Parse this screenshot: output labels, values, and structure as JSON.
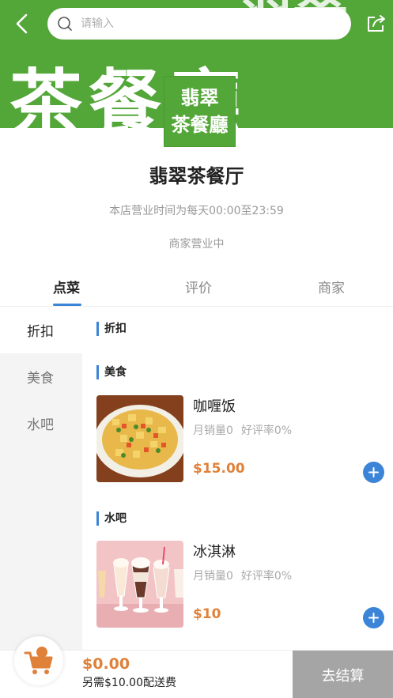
{
  "header": {
    "search_placeholder": "请输入",
    "banner_text_large": "茶餐廳",
    "banner_text_top": "翡翠"
  },
  "store": {
    "logo_line1": "翡翠",
    "logo_line2": "茶餐廳",
    "name": "翡翠茶餐厅",
    "hours": "本店营业时间为每天00:00至23:59",
    "status": "商家营业中",
    "brand_color": "#53a638"
  },
  "tabs": [
    {
      "label": "点菜",
      "active": true
    },
    {
      "label": "评价",
      "active": false
    },
    {
      "label": "商家",
      "active": false
    }
  ],
  "categories": [
    {
      "label": "折扣",
      "active": true
    },
    {
      "label": "美食",
      "active": false
    },
    {
      "label": "水吧",
      "active": false
    }
  ],
  "sections": [
    {
      "title": "折扣",
      "items": []
    },
    {
      "title": "美食",
      "items": [
        {
          "name": "咖喱饭",
          "monthly_sales": "月销量0",
          "rating": "好评率0%",
          "price": "$15.00",
          "image": "curry-rice-photo"
        }
      ]
    },
    {
      "title": "水吧",
      "items": [
        {
          "name": "冰淇淋",
          "monthly_sales": "月销量0",
          "rating": "好评率0%",
          "price": "$10",
          "image": "ice-cream-photo"
        }
      ]
    }
  ],
  "cart": {
    "total": "$0.00",
    "delivery_note": "另需$10.00配送费",
    "checkout_label": "去结算"
  },
  "colors": {
    "accent": "#3b84d8",
    "price": "#e0813a",
    "checkout_disabled": "#a5a5a5"
  },
  "icons": {
    "back": "back-arrow-icon",
    "search": "search-icon",
    "share": "share-icon",
    "add": "plus-icon",
    "cart": "cart-icon"
  }
}
